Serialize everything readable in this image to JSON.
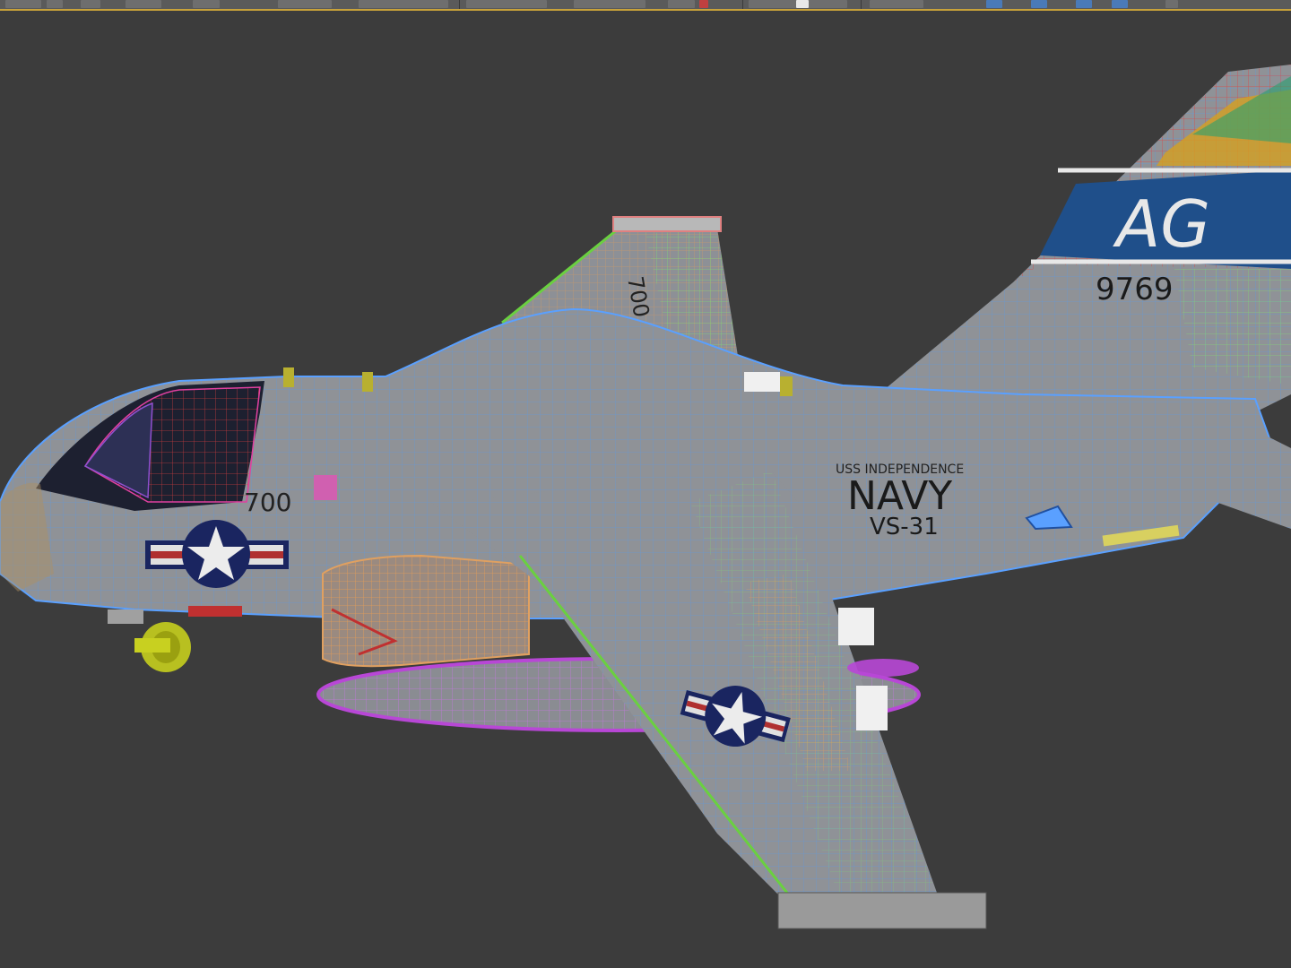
{
  "viewport": {
    "tail_code": "AG",
    "tail_number": "9769",
    "ship": "USS INDEPENDENCE",
    "service": "NAVY",
    "squadron": "VS-31",
    "nose_number": "700",
    "wing_number": "700"
  },
  "colors": {
    "viewport_bg": "#3c3c3c",
    "toolbar_bg": "#5a5a5a",
    "toolbar_accent": "#c8a23a",
    "skin": "#8f9297",
    "wire_blue": "#4f8fe0",
    "tank_purple": "#b847d6",
    "engine_orange": "#e0a060",
    "wheel_yellow": "#c8d020",
    "insignia_navy": "#1a2560"
  },
  "icons": [
    "star-insignia",
    "toolbar-button-icons"
  ]
}
